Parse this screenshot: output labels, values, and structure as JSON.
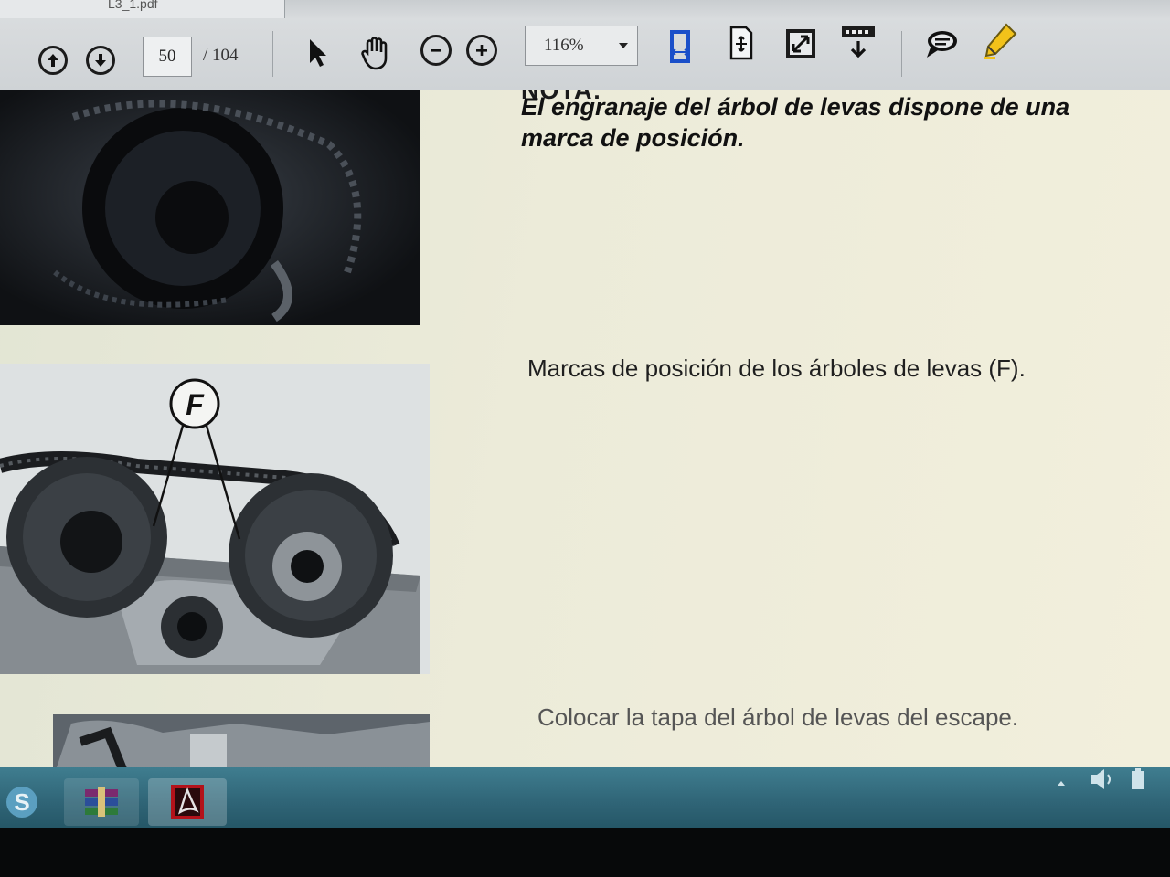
{
  "window": {
    "tab_title": "L3_1.pdf"
  },
  "toolbar": {
    "prev_page": "previous-page",
    "next_page": "next-page",
    "current_page": "50",
    "total_pages": "/  104",
    "zoom": "116%"
  },
  "icons": {
    "prev": "arrow-up-circle-icon",
    "next": "arrow-down-circle-icon",
    "select": "cursor-arrow-icon",
    "hand": "hand-icon",
    "zoom_out": "zoom-out-icon",
    "zoom_in": "zoom-in-icon",
    "fit_width": "fit-width-icon",
    "fit_page": "fit-page-icon",
    "fullscreen": "fullscreen-icon",
    "scroll_mode": "scroll-mode-icon",
    "comment": "comment-icon",
    "highlight": "highlight-pen-icon"
  },
  "document": {
    "note_heading": "NOTA:",
    "note_text": "El engranaje del árbol de levas dispone de una marca de posición.",
    "caption_marks": "Marcas de posición de los árboles de levas (F).",
    "caption_cover": "Colocar la tapa del árbol de levas del escape.",
    "figure_label": "F"
  },
  "colors": {
    "toolbar_bg": "#d6d9dc",
    "accent_blue": "#1a4fc9",
    "taskbar": "#2f6476",
    "highlight_yellow": "#f2c21a"
  },
  "taskbar": {
    "apps": [
      "skype-icon",
      "winrar-icon",
      "acrobat-reader-icon"
    ]
  }
}
